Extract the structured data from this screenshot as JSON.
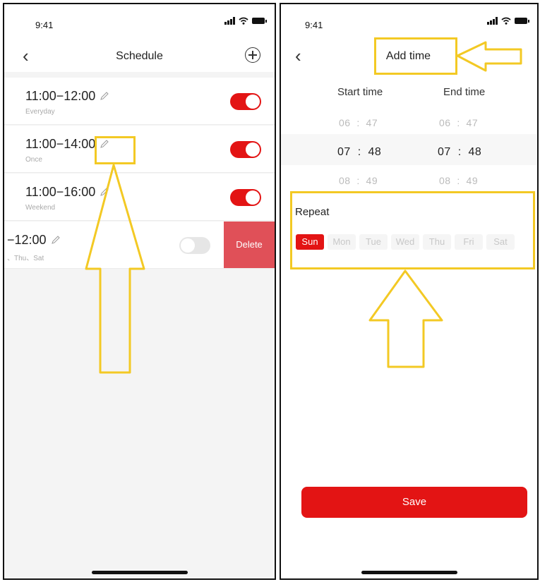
{
  "status_bar": {
    "time": "9:41"
  },
  "left": {
    "nav": {
      "title": "Schedule"
    },
    "schedules": [
      {
        "time": "11:00−12:00",
        "repeat": "Everyday",
        "enabled": true
      },
      {
        "time": "11:00−14:00",
        "repeat": "Once",
        "enabled": true
      },
      {
        "time": "11:00−16:00",
        "repeat": "Weekend",
        "enabled": true
      },
      {
        "time": "−12:00",
        "repeat": "、Thu、Sat",
        "enabled": false
      }
    ],
    "delete_label": "Delete"
  },
  "right": {
    "nav": {
      "title": "Add time"
    },
    "start_label": "Start time",
    "end_label": "End time",
    "picker_rows": [
      {
        "start_h": "06",
        "start_m": "47",
        "end_h": "06",
        "end_m": "47"
      },
      {
        "start_h": "07",
        "start_m": "48",
        "end_h": "07",
        "end_m": "48"
      },
      {
        "start_h": "08",
        "start_m": "49",
        "end_h": "08",
        "end_m": "49"
      }
    ],
    "separator": ":",
    "repeat_label": "Repeat",
    "days": [
      "Sun",
      "Mon",
      "Tue",
      "Wed",
      "Thu",
      "Fri",
      "Sat"
    ],
    "selected_day": "Sun",
    "save_label": "Save"
  },
  "colors": {
    "accent": "#e31414",
    "delete": "#e05058",
    "highlight": "#f3c924"
  }
}
